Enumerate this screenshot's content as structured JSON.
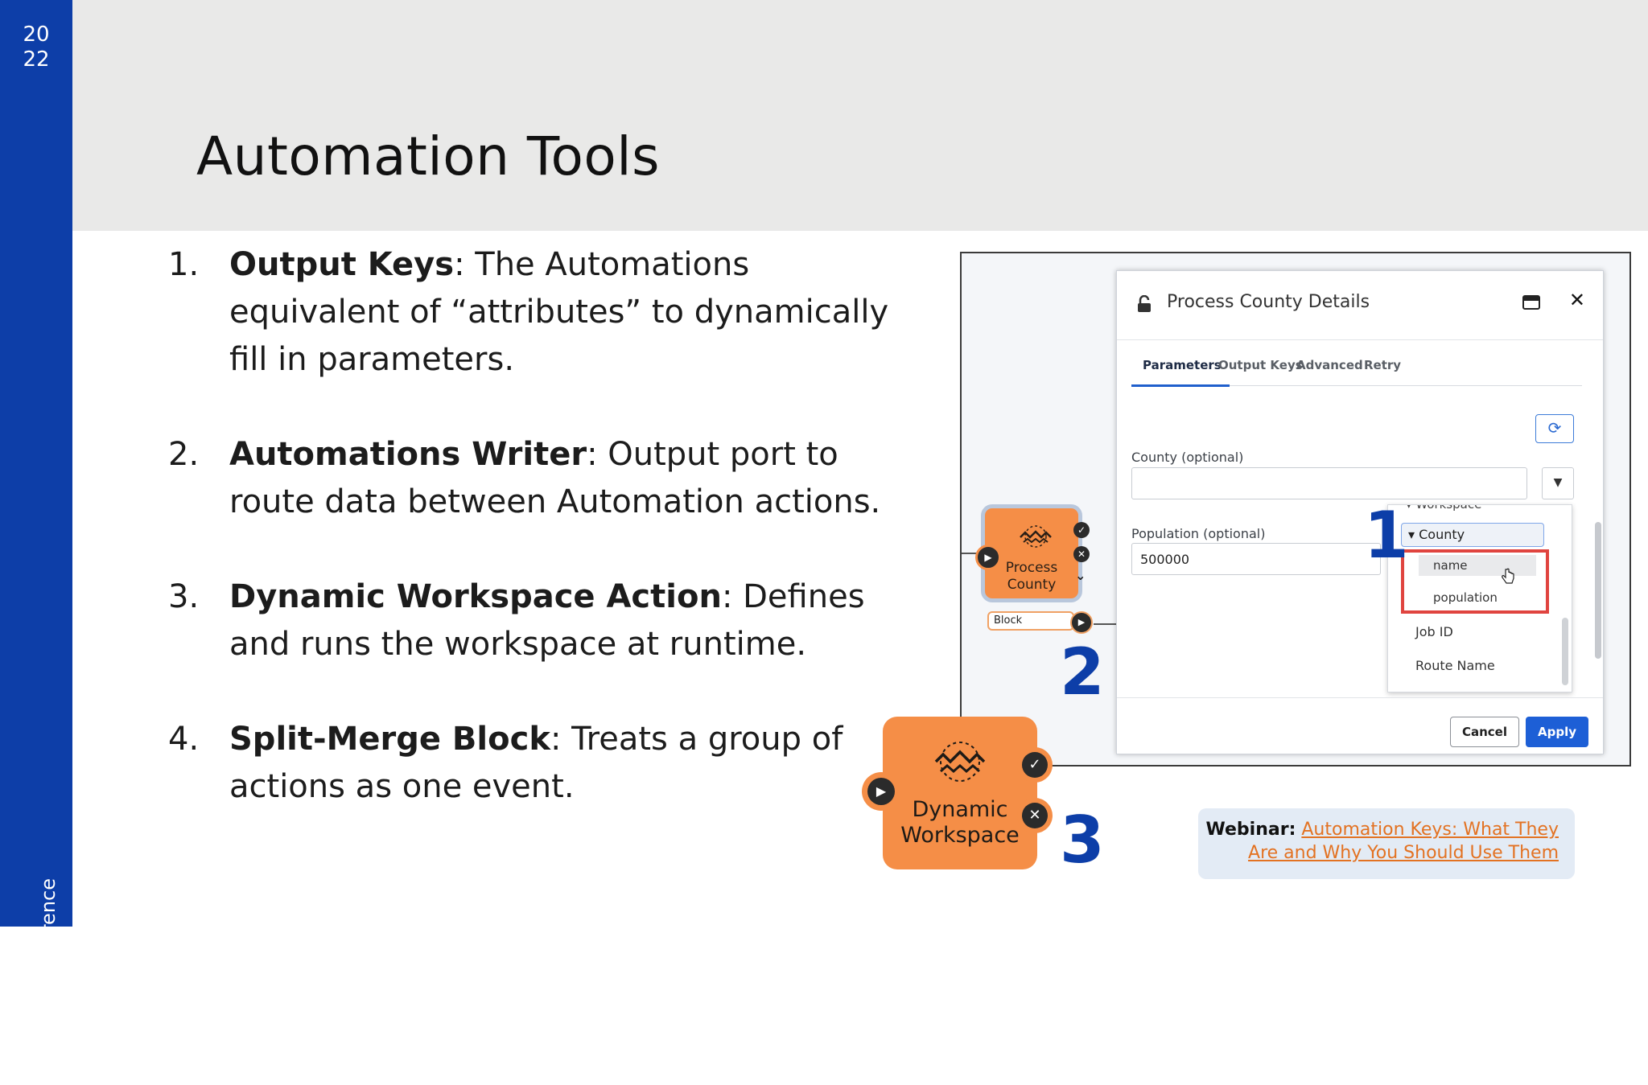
{
  "slide": {
    "year_top": "20",
    "year_bottom": "22",
    "conference": "FME User Conference",
    "title": "Automation Tools"
  },
  "list": [
    {
      "num": "1.",
      "term": "Output Keys",
      "desc": ": The Automations equivalent of “attributes” to dynamically fill in parameters."
    },
    {
      "num": "2.",
      "term": "Automations Writer",
      "desc": ": Output port to route data between Automation actions."
    },
    {
      "num": "3.",
      "term": "Dynamic Workspace Action",
      "desc": ": Defines and runs the workspace at runtime."
    },
    {
      "num": "4.",
      "term": "Split-Merge Block",
      "desc": ": Treats a group of actions as one event."
    }
  ],
  "dialog": {
    "title": "Process County Details",
    "tabs": [
      "Parameters",
      "Output Keys",
      "Advanced",
      "Retry"
    ],
    "active_tab": "Parameters",
    "county_label": "County (optional)",
    "county_value": "",
    "population_label": "Population (optional)",
    "population_value": "500000",
    "dropdown": {
      "group": "Workspace",
      "selected": "County",
      "sub_items": [
        "name",
        "population"
      ],
      "items": [
        "Job ID",
        "Route Name"
      ]
    },
    "cancel": "Cancel",
    "apply": "Apply"
  },
  "process_node": {
    "label_line1": "Process",
    "label_line2": "County",
    "block_label": "Block"
  },
  "dynamic_node": {
    "label_line1": "Dynamic",
    "label_line2": "Workspace"
  },
  "markers": [
    "1",
    "2",
    "3"
  ],
  "webinar": {
    "prefix": "Webinar:",
    "link_line1": "Automation Keys: What They",
    "link_line2": "Are and Why You Should Use Them"
  },
  "colors": {
    "brand_blue": "#0d3ea8",
    "node_orange": "#f58e47",
    "apply_blue": "#1d5fd6",
    "highlight_red": "#e0443f",
    "link_orange": "#e37222"
  }
}
